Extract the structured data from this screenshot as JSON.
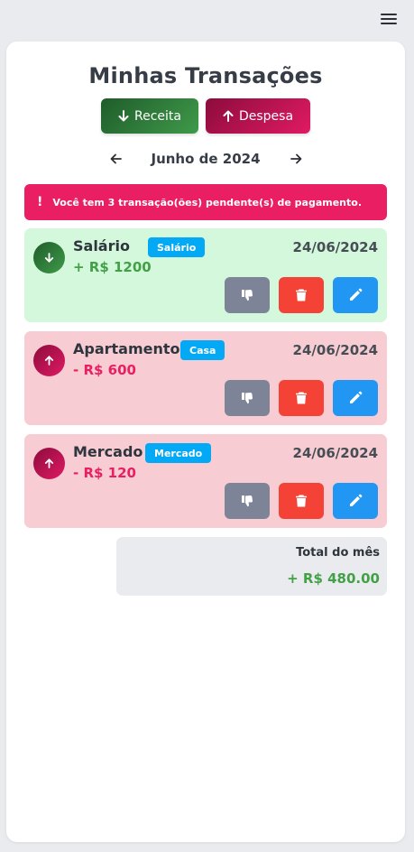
{
  "header": {
    "menu_icon": "hamburger-menu-icon"
  },
  "title": "Minhas Transações",
  "actions": {
    "receita_label": "Receita",
    "despesa_label": "Despesa"
  },
  "month_nav": {
    "label": "Junho de 2024",
    "prev_icon": "arrow-left-icon",
    "next_icon": "arrow-right-icon"
  },
  "alert": {
    "icon": "!",
    "text": "Você tem 3 transação(ões) pendente(s) de pagamento."
  },
  "transactions": [
    {
      "type": "income",
      "name": "Salário",
      "category": "Salário",
      "date": "24/06/2024",
      "amount": "+ R$ 1200"
    },
    {
      "type": "expense",
      "name": "Apartamento",
      "category": "Casa",
      "date": "24/06/2024",
      "amount": "- R$ 600"
    },
    {
      "type": "expense",
      "name": "Mercado",
      "category": "Mercado",
      "date": "24/06/2024",
      "amount": "- R$ 120"
    }
  ],
  "total": {
    "label": "Total do mês",
    "value": "+ R$ 480.00"
  },
  "colors": {
    "income_bg": "#d4f8dc",
    "expense_bg": "#f7ccd3",
    "alert": "#e91e63",
    "income_text": "#43a047",
    "expense_text": "#e91e63",
    "tag": "#03a9f4",
    "unpaid_btn": "#7d8498",
    "delete_btn": "#f44336",
    "edit_btn": "#2196f3"
  }
}
